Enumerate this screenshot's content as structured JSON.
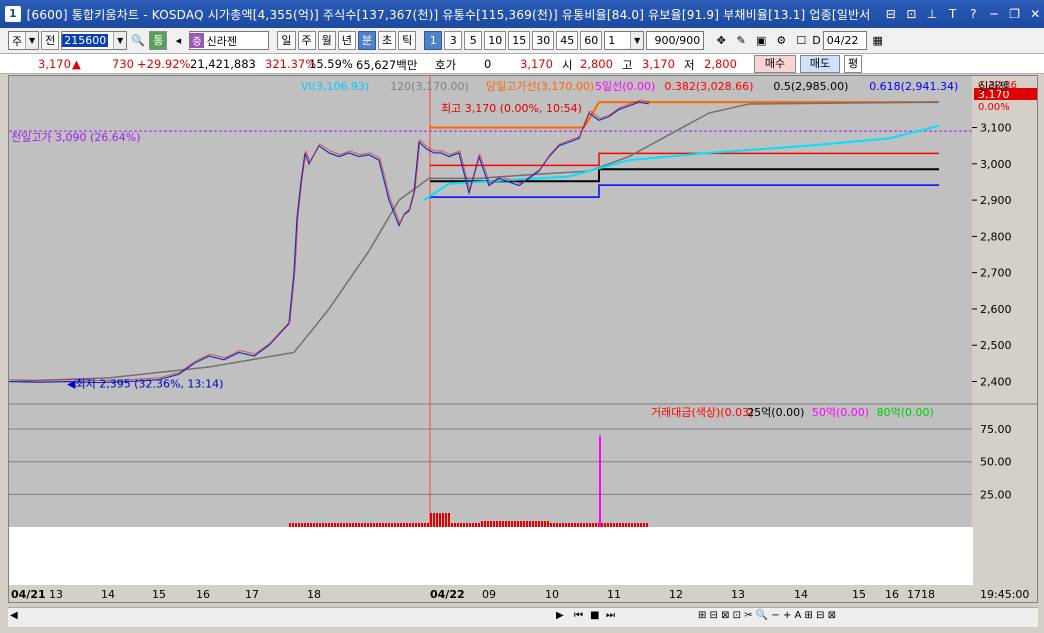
{
  "window": {
    "icon_label": "1",
    "title": "[6600] 통합키움차트 - KOSDAQ 시가총액[4,355(억)] 주식수[137,367(천)] 유통수[115,369(천)] 유통비율[84.0] 유보율[91.9] 부채비율[13.1] 업종[일반서",
    "buttons": [
      "⊟",
      "⊡",
      "📌",
      "T",
      "?",
      "─",
      "❐",
      "✕"
    ]
  },
  "toolbar": {
    "period_select": "주",
    "prev_label": "전",
    "stock_code": "215600",
    "stock_name": "신라젠",
    "tong_label": "통",
    "period_buttons": [
      "일",
      "주",
      "월",
      "년",
      "분",
      "초",
      "틱"
    ],
    "active_period": "분",
    "minute_buttons": [
      "1",
      "3",
      "5",
      "10",
      "15",
      "30",
      "45",
      "60"
    ],
    "active_minute": "1",
    "interval_value": "1",
    "count_value": "900/900",
    "date_label": "D",
    "date_value": "04/22"
  },
  "quote": {
    "price": "3,170",
    "change": "730",
    "change_pct": "+29.92%",
    "volume": "21,421,883",
    "volume_ratio": "321.37%",
    "turnover": "15.59%",
    "amount": "65,627백만",
    "hoga_label": "호가",
    "hoga_value": "0",
    "hoga_price": "3,170",
    "open_label": "시",
    "open": "2,800",
    "high_label": "고",
    "high": "3,170",
    "low_label": "저",
    "low": "2,800",
    "buy_label": "매수",
    "sell_label": "매도",
    "eval_label": "평"
  },
  "chart_data": [
    {
      "type": "line",
      "title": "",
      "legend": [
        {
          "name": "VI(3,106.93)",
          "color": "#00ccff"
        },
        {
          "name": "120(3,170.00)",
          "color": "#808080"
        },
        {
          "name": "당일고가선(3,170.00)",
          "color": "#ff6600"
        },
        {
          "name": "5일선(0.00)",
          "color": "#ff00ff"
        },
        {
          "name": "0.382(3,028.66)",
          "color": "#ff0000"
        },
        {
          "name": "0.5(2,985.00)",
          "color": "#000000"
        },
        {
          "name": "0.618(2,941.34)",
          "color": "#0000ff"
        },
        {
          "name": "신라젠",
          "color": "#000000"
        }
      ],
      "y_ticks": [
        "3,100",
        "3,000",
        "2,900",
        "2,800",
        "2,700",
        "2,600",
        "2,500",
        "2,400"
      ],
      "ylim": [
        2360,
        3220
      ],
      "right_labels": {
        "current": "3,170",
        "change_pct": "C:32.36",
        "pct_zero": "0.00%"
      },
      "annotations": [
        {
          "text": "전일고가 3,090 (26.64%)",
          "y": 3090
        },
        {
          "text": "최고 3,170 (0.00%, 10:54)",
          "y": 3170
        },
        {
          "text": "최저 2,395 (32.36%, 13:14)",
          "y": 2395
        }
      ],
      "fib_levels": [
        {
          "label": "0.382",
          "value": 3028.66,
          "color": "#ff0000"
        },
        {
          "label": "0.5",
          "value": 2985.0,
          "color": "#000000"
        },
        {
          "label": "0.618",
          "value": 2941.34,
          "color": "#0000ff"
        }
      ],
      "price_series_x": [
        0,
        30,
        60,
        90,
        120,
        150,
        170,
        185,
        200,
        215,
        230,
        245,
        260,
        270,
        280,
        285,
        288,
        292,
        296,
        300,
        310,
        320,
        330,
        340,
        350,
        360,
        370,
        380,
        390,
        395,
        400,
        405,
        410,
        418,
        425,
        432,
        440,
        450,
        460,
        470,
        480,
        490,
        500,
        510,
        520,
        530,
        540,
        550,
        560,
        570,
        580,
        590,
        600,
        610,
        620,
        630,
        640
      ],
      "price_series_y": [
        2400,
        2398,
        2400,
        2397,
        2400,
        2405,
        2420,
        2450,
        2470,
        2460,
        2480,
        2470,
        2500,
        2530,
        2560,
        2700,
        2850,
        2950,
        3030,
        3000,
        3050,
        3030,
        3020,
        3030,
        3020,
        3025,
        3010,
        2900,
        2830,
        2860,
        2870,
        2920,
        3060,
        3040,
        3030,
        3030,
        3020,
        3030,
        2920,
        3020,
        2940,
        2960,
        2950,
        2940,
        2960,
        2980,
        3020,
        3050,
        3060,
        3070,
        3140,
        3120,
        3130,
        3150,
        3160,
        3170,
        3165
      ]
    },
    {
      "type": "bar",
      "title": "",
      "legend": [
        {
          "name": "거래대금(색상)(0.03)",
          "color": "#ff0000"
        },
        {
          "name": "25억(0.00)",
          "color": "#000000"
        },
        {
          "name": "50억(0.00)",
          "color": "#ff00ff"
        },
        {
          "name": "80억(0.00)",
          "color": "#00cc00"
        }
      ],
      "y_ticks": [
        "75.00",
        "50.00",
        "25.00"
      ],
      "ylim": [
        0,
        85
      ]
    }
  ],
  "x_axis": {
    "labels": [
      "04/21",
      "13",
      "14",
      "15",
      "16",
      "17",
      "18",
      "04/22",
      "09",
      "10",
      "11",
      "12",
      "13",
      "14",
      "15",
      "16",
      "17",
      "18"
    ],
    "time_label": "19:45:00"
  }
}
